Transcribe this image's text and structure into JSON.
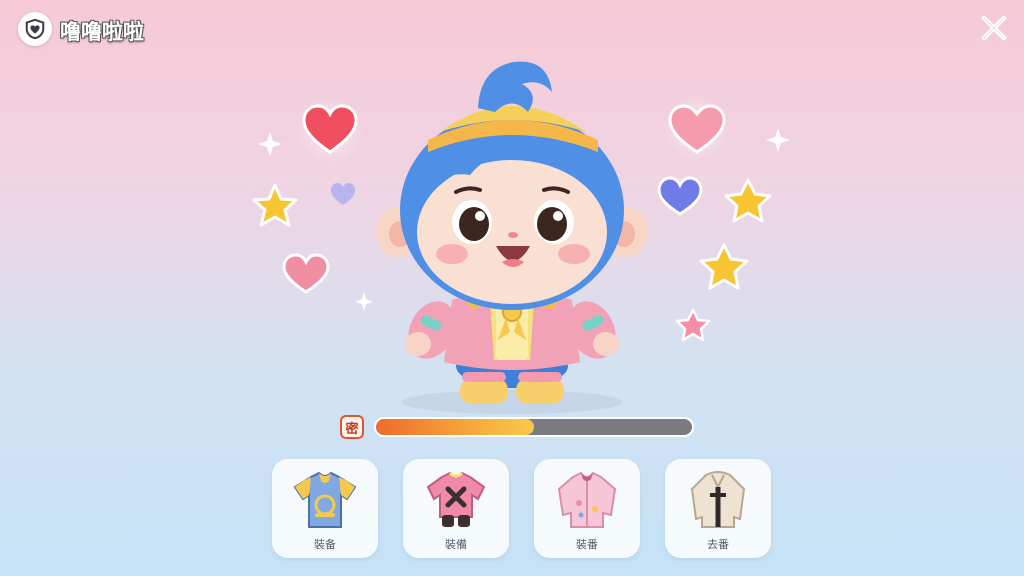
{
  "header": {
    "title": "噜噜啦啦",
    "badge_icon": "heart-shield-icon"
  },
  "controls": {
    "close_icon": "close-icon"
  },
  "progress": {
    "icon_text": "密",
    "fraction": 0.5,
    "fill_colors": [
      "#f06b2d",
      "#f8c94a"
    ]
  },
  "outfits": [
    {
      "label": "裝备",
      "icon": "blue-tshirt-icon",
      "color": "#7fa9e0"
    },
    {
      "label": "裝備",
      "icon": "pink-vest-outfit-icon",
      "color": "#f08aa8"
    },
    {
      "label": "裝番",
      "icon": "pink-jacket-icon",
      "color": "#f7c6d6"
    },
    {
      "label": "去番",
      "icon": "beige-coat-icon",
      "color": "#e8dccb"
    }
  ],
  "character": {
    "name_icon": "blue-haired-character"
  },
  "decorations": [
    "heart-icon",
    "star-icon",
    "sparkle-icon"
  ]
}
